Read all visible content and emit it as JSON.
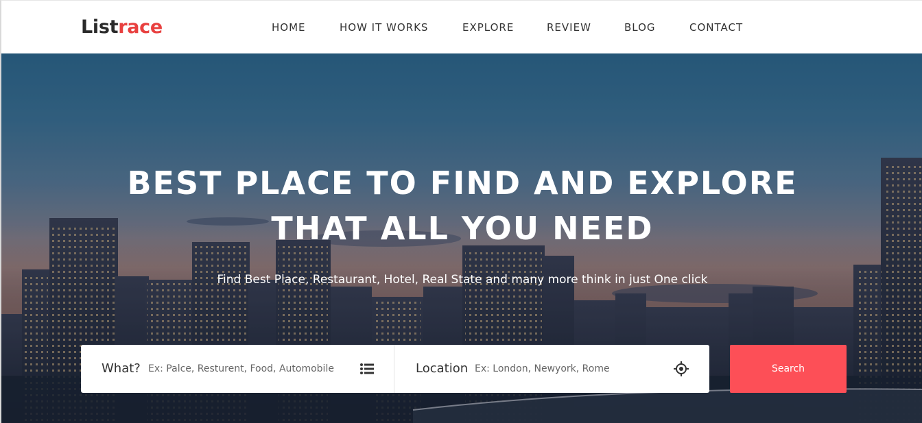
{
  "logo": {
    "part1": "List",
    "part2": "race"
  },
  "nav": [
    {
      "label": "HOME"
    },
    {
      "label": "HOW IT WORKS"
    },
    {
      "label": "EXPLORE"
    },
    {
      "label": "REVIEW"
    },
    {
      "label": "BLOG"
    },
    {
      "label": "CONTACT"
    }
  ],
  "hero": {
    "title_line1": "BEST PLACE TO FIND AND EXPLORE",
    "title_line2": "THAT ALL YOU NEED",
    "subtitle": "Find Best Place, Restaurant, Hotel, Real State and many more think in just One click"
  },
  "search": {
    "what_label": "What?",
    "what_placeholder": "Ex: Palce, Resturent, Food, Automobile",
    "what_icon": "list-icon",
    "location_label": "Location",
    "location_placeholder": "Ex: London, Newyork, Rome",
    "location_icon": "crosshair-icon",
    "button_label": "Search"
  },
  "colors": {
    "accent": "#e8403f",
    "button": "#fd4f57",
    "text_dark": "#2a2a2a"
  }
}
